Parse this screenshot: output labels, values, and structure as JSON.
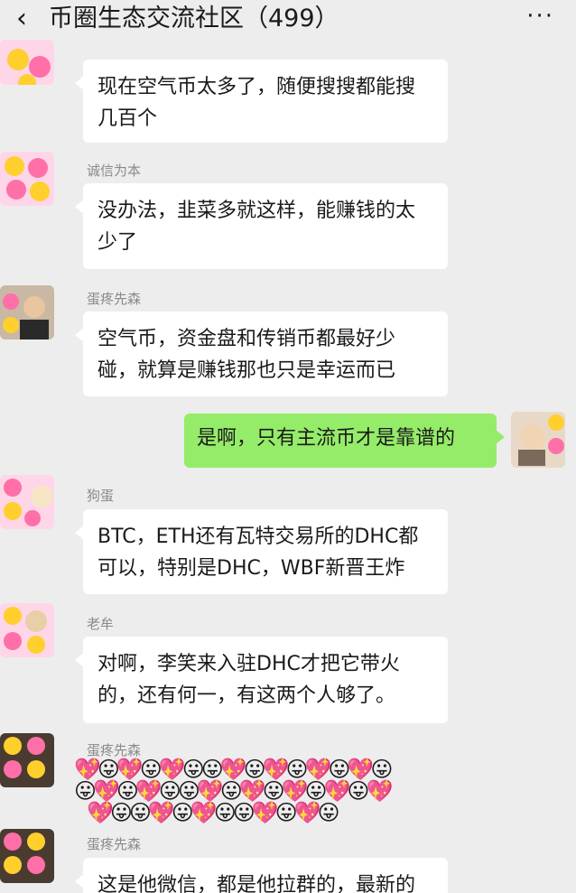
{
  "header": {
    "back_icon": "‹",
    "title": "币圈生态交流社区（499）",
    "more_icon": "···"
  },
  "messages": [
    {
      "sender": "",
      "text": "现在空气币太多了，随便搜搜都能搜几百个"
    },
    {
      "sender": "诚信为本",
      "text": "没办法，韭菜多就这样，能赚钱的太少了"
    },
    {
      "sender": "蛋疼先森",
      "text": "空气币，资金盘和传销币都最好少碰，就算是赚钱那也只是幸运而已"
    },
    {
      "sender": "",
      "text": "是啊，只有主流币才是靠谱的",
      "self": true
    },
    {
      "sender": "狗蛋",
      "text": "BTC，ETH还有瓦特交易所的DHC都可以，特别是DHC，WBF新晋王炸"
    },
    {
      "sender": "老牟",
      "text": "对啊，李笑来入驻DHC才把它带火的，还有何一，有这两个人够了。"
    },
    {
      "sender": "蛋疼先森",
      "text": "😛💖😛💖😛😛💖😛💖😛💖😛💖😛"
    },
    {
      "sender": "蛋疼先森",
      "text": "这是他微信，都是他拉群的，最新的"
    }
  ],
  "emoji_rows": {
    "row1": "💖😛💖😛💖😛😛💖😛💖😛💖😛💖😛",
    "row2": "😛💖😛💖😛😛💖😛💖😛💖😛💖😛💖",
    "row3": "💖😛😛💖😛💖😛😛💖😛💖😛"
  }
}
